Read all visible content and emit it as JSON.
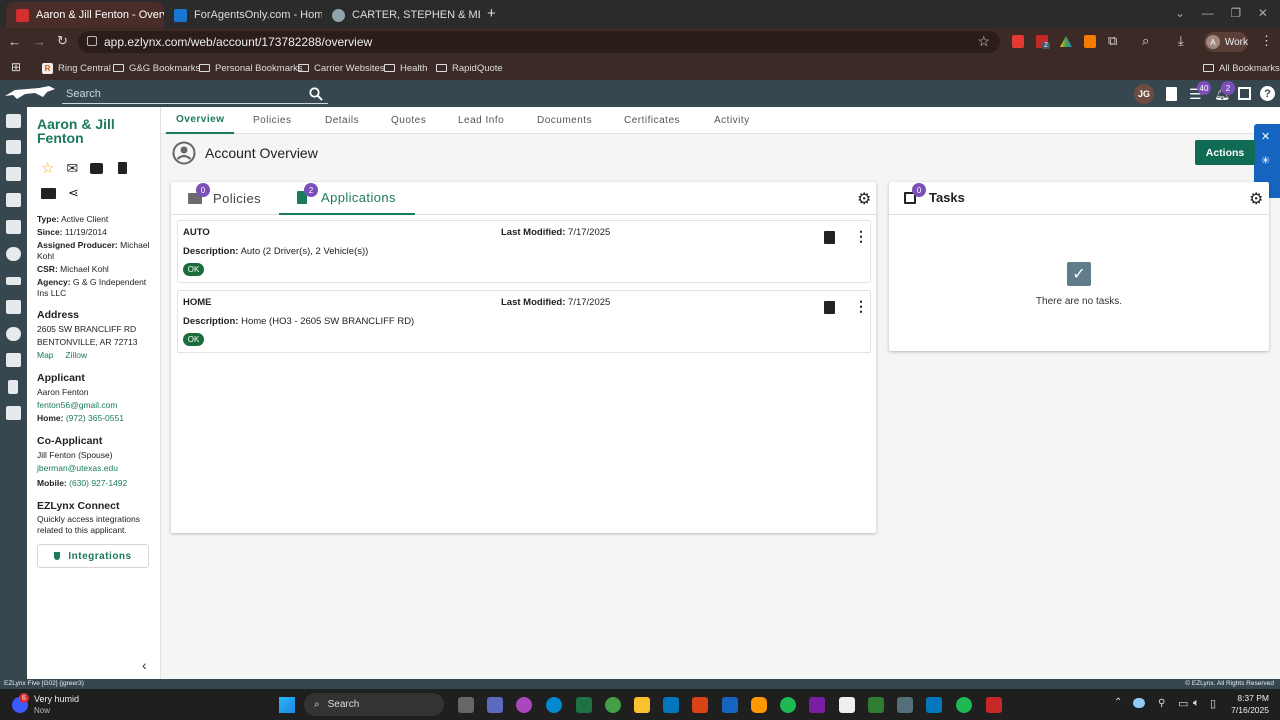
{
  "browser": {
    "tabs": [
      {
        "title": "Aaron & Jill Fenton - Overview",
        "active": true,
        "fav": "#d32f2f"
      },
      {
        "title": "ForAgentsOnly.com - Home",
        "active": false,
        "fav": "#1976d2"
      },
      {
        "title": "CARTER, STEPHEN & MELISSA -",
        "active": false,
        "fav": "#90a4ae"
      }
    ],
    "url": "app.ezlynx.com/web/account/173782288/overview",
    "profile_label": "Work",
    "profile_initial": "A",
    "ext_badge": "2",
    "bookmarks": [
      "Ring Central",
      "G&G Bookmarks",
      "Personal Bookmarks",
      "Carrier Websites",
      "Health",
      "RapidQuote"
    ],
    "all_bookmarks": "All Bookmarks"
  },
  "header": {
    "search_placeholder": "Search",
    "user_initials": "JG",
    "notif_count": "40",
    "alert_count": "2"
  },
  "account": {
    "name_line1": "Aaron & Jill",
    "name_line2": "Fenton",
    "type_label": "Type:",
    "type": "Active Client",
    "since_label": "Since:",
    "since": "11/19/2014",
    "producer_label": "Assigned Producer:",
    "producer": "Michael Kohl",
    "csr_label": "CSR:",
    "csr": "Michael Kohl",
    "agency_label": "Agency:",
    "agency": "G & G Independent Ins LLC",
    "address_title": "Address",
    "address_line1": "2605 SW BRANCLIFF RD",
    "address_line2": "BENTONVILLE, AR 72713",
    "map": "Map",
    "zillow": "Zillow",
    "applicant_title": "Applicant",
    "applicant_name": "Aaron Fenton",
    "applicant_email": "fenton56@gmail.com",
    "home_label": "Home:",
    "applicant_home": "(972) 365-0551",
    "coapplicant_title": "Co-Applicant",
    "coapplicant_name": "Jill Fenton (Spouse)",
    "coapplicant_email": "jberman@utexas.edu",
    "mobile_label": "Mobile:",
    "coapplicant_mobile": "(630) 927-1492",
    "connect_title": "EZLynx Connect",
    "connect_desc": "Quickly access integrations related to this applicant.",
    "integrations_label": "Integrations"
  },
  "nav_tabs": [
    "Overview",
    "Policies",
    "Details",
    "Quotes",
    "Lead Info",
    "Documents",
    "Certificates",
    "Activity"
  ],
  "overview": {
    "title": "Account Overview",
    "actions_label": "Actions",
    "policies_tab": "Policies",
    "policies_count": "0",
    "applications_tab": "Applications",
    "applications_count": "2",
    "tasks_title": "Tasks",
    "tasks_count": "0",
    "no_tasks": "There are no tasks.",
    "last_modified_label": "Last Modified:",
    "description_label": "Description:",
    "applications": [
      {
        "type": "AUTO",
        "modified": "7/17/2025",
        "description": "Auto (2 Driver(s), 2 Vehicle(s))",
        "status": "OK"
      },
      {
        "type": "HOME",
        "modified": "7/17/2025",
        "description": "Home (HO3 - 2605 SW BRANCLIFF RD)",
        "status": "OK"
      }
    ]
  },
  "footer": {
    "left": "EZLynx Five [G02] (jgreer3)",
    "right": "© EZLynx. All Rights Reserved"
  },
  "taskbar": {
    "weather": "Very humid",
    "weather_sub": "Now",
    "weather_badge": "6",
    "search": "Search",
    "time": "8:37 PM",
    "date": "7/16/2025"
  },
  "colors": {
    "accent": "#1a7a5e",
    "header": "#37474f",
    "badge": "#7b4fb8",
    "button": "#0f6b53"
  }
}
